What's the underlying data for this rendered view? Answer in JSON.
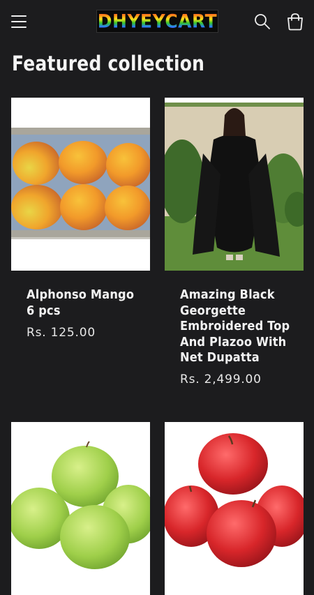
{
  "header": {
    "logo_text": "DHYEYCART",
    "menu_icon": "hamburger-menu-icon",
    "search_icon": "search-icon",
    "cart_icon": "shopping-bag-icon"
  },
  "section": {
    "title": "Featured collection"
  },
  "products": [
    {
      "name": "Alphonso Mango 6 pcs",
      "price": "Rs. 125.00",
      "image": "mangoes"
    },
    {
      "name": "Amazing Black Georgette Embroidered Top And Plazoo With Net Dupatta",
      "price": "Rs. 2,499.00",
      "image": "black-embroidered-dress"
    },
    {
      "name": "",
      "price": "",
      "image": "green-apples"
    },
    {
      "name": "",
      "price": "",
      "image": "red-apples"
    }
  ],
  "colors": {
    "background": "#1c1c1e",
    "text": "#f2f2f2",
    "card_bg": "#ffffff"
  }
}
